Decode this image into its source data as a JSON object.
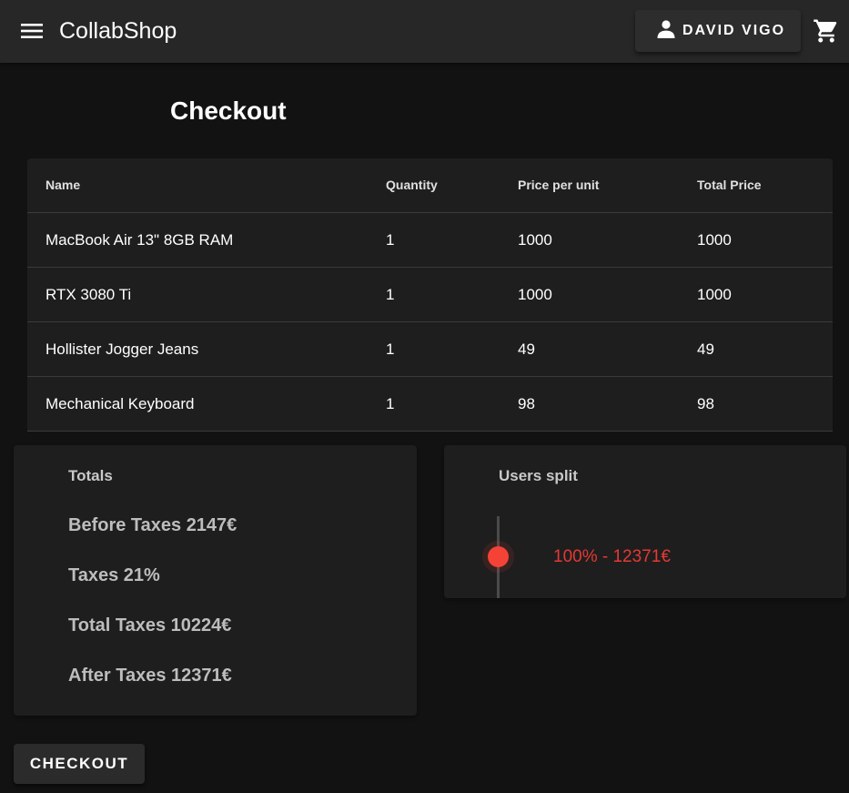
{
  "app": {
    "title": "CollabShop",
    "user_label": "DAVID VIGO",
    "icons": {
      "menu": "menu-icon",
      "user": "person-icon",
      "cart": "shopping-cart-icon"
    }
  },
  "page": {
    "title": "Checkout"
  },
  "table": {
    "headers": [
      "Name",
      "Quantity",
      "Price per unit",
      "Total Price"
    ],
    "rows": [
      {
        "name": "MacBook Air 13\" 8GB RAM",
        "quantity": "1",
        "price": "1000",
        "total": "1000"
      },
      {
        "name": "RTX 3080 Ti",
        "quantity": "1",
        "price": "1000",
        "total": "1000"
      },
      {
        "name": "Hollister Jogger Jeans",
        "quantity": "1",
        "price": "49",
        "total": "49"
      },
      {
        "name": "Mechanical Keyboard",
        "quantity": "1",
        "price": "98",
        "total": "98"
      }
    ]
  },
  "totals": {
    "heading": "Totals",
    "lines": [
      "Before Taxes 2147€",
      "Taxes 21%",
      "Total Taxes 10224€",
      "After Taxes 12371€"
    ]
  },
  "split": {
    "heading": "Users split",
    "label": "100% - 12371€",
    "value_percent": 100
  },
  "checkout_label": "CHECKOUT",
  "colors": {
    "accent": "#f44336",
    "split_text": "#e53935",
    "background": "#121212",
    "surface": "#1e1e1e",
    "appbar": "#272727"
  }
}
